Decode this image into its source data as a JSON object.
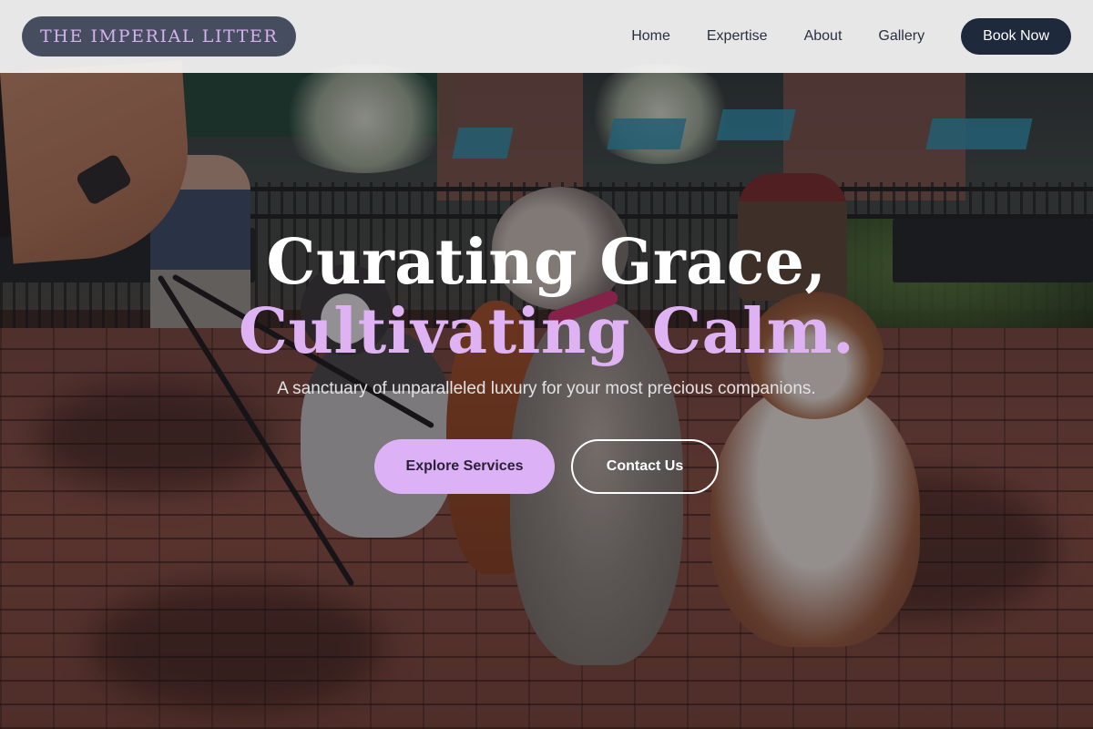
{
  "brand": {
    "logo_text": "THE IMPERIAL LITTER"
  },
  "nav": {
    "items": [
      {
        "label": "Home"
      },
      {
        "label": "Expertise"
      },
      {
        "label": "About"
      },
      {
        "label": "Gallery"
      }
    ],
    "cta_label": "Book Now"
  },
  "hero": {
    "title_line1": "Curating Grace,",
    "title_line2": "Cultivating Calm.",
    "subtitle": "A sanctuary of unparalleled luxury for your most precious companions.",
    "primary_button": "Explore Services",
    "secondary_button": "Contact Us"
  },
  "colors": {
    "header_bg": "#f6f6f6",
    "logo_bg": "#464d5f",
    "logo_text": "#d5b1ee",
    "book_button_bg": "#1e293b",
    "accent_lavender": "#dcb1f5",
    "title_white": "#ffffff"
  }
}
